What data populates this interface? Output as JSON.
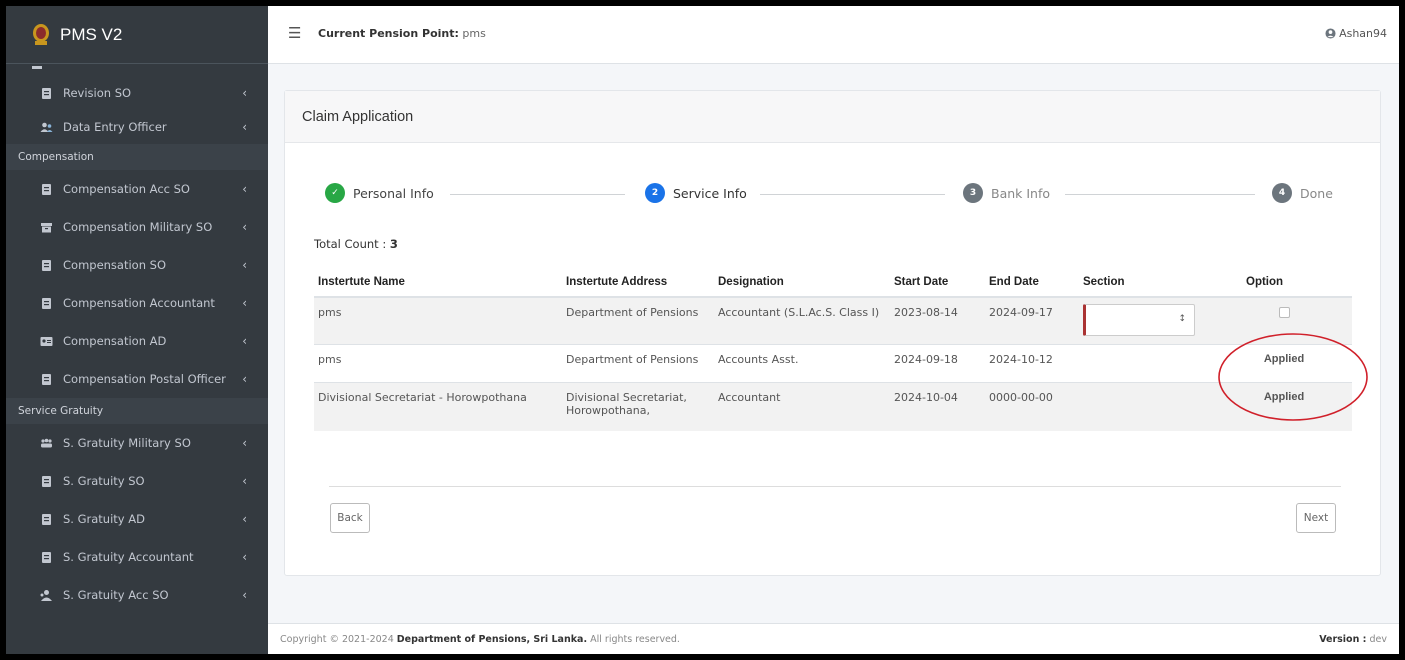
{
  "app": {
    "brand": "PMS V2"
  },
  "sidebar": {
    "items_top": [
      {
        "label": "Revision SO",
        "icon": "file-icon"
      },
      {
        "label": "Data Entry Officer",
        "icon": "users-icon"
      }
    ],
    "compensation_header": "Compensation",
    "compensation_items": [
      {
        "label": "Compensation Acc SO",
        "icon": "file-icon"
      },
      {
        "label": "Compensation Military SO",
        "icon": "archive-icon"
      },
      {
        "label": "Compensation SO",
        "icon": "file-icon"
      },
      {
        "label": "Compensation Accountant",
        "icon": "file-icon"
      },
      {
        "label": "Compensation AD",
        "icon": "id-card-icon"
      },
      {
        "label": "Compensation Postal Officer",
        "icon": "file-icon"
      }
    ],
    "gratuity_header": "Service Gratuity",
    "gratuity_items": [
      {
        "label": "S. Gratuity Military SO",
        "icon": "people-icon"
      },
      {
        "label": "S. Gratuity SO",
        "icon": "file-icon"
      },
      {
        "label": "S. Gratuity AD",
        "icon": "file-icon"
      },
      {
        "label": "S. Gratuity Accountant",
        "icon": "file-icon"
      },
      {
        "label": "S. Gratuity Acc SO",
        "icon": "user-tie-icon"
      }
    ]
  },
  "header": {
    "pension_point_label": "Current Pension Point:",
    "pension_point_value": "pms",
    "username": "Ashan94"
  },
  "card": {
    "title": "Claim Application"
  },
  "stepper": [
    {
      "number": "✓",
      "label": "Personal Info",
      "state": "completed",
      "color": "#28a745"
    },
    {
      "number": "2",
      "label": "Service Info",
      "state": "active",
      "color": "#1a73e8"
    },
    {
      "number": "3",
      "label": "Bank Info",
      "state": "pending",
      "color": "#6c757d"
    },
    {
      "number": "4",
      "label": "Done",
      "state": "pending",
      "color": "#6c757d"
    }
  ],
  "total_count": {
    "label": "Total Count :",
    "value": "3"
  },
  "table": {
    "headers": [
      "Instertute Name",
      "Instertute Address",
      "Designation",
      "Start Date",
      "End Date",
      "Section",
      "Option"
    ],
    "rows": [
      {
        "name": "pms",
        "address": "Department of Pensions",
        "designation": "Accountant (S.L.Ac.S. Class I)",
        "start": "2023-08-14",
        "end": "2024-09-17",
        "section": "",
        "option": ""
      },
      {
        "name": "pms",
        "address": "Department of Pensions",
        "designation": "Accounts Asst.",
        "start": "2024-09-18",
        "end": "2024-10-12",
        "section": "",
        "option": "Applied"
      },
      {
        "name": "Divisional Secretariat - Horowpothana",
        "address": "Divisional Secretariat, Horowpothana,",
        "designation": "Accountant",
        "start": "2024-10-04",
        "end": "0000-00-00",
        "section": "",
        "option": "Applied"
      }
    ]
  },
  "buttons": {
    "back": "Back",
    "next": "Next"
  },
  "footer": {
    "copyright_prefix": "Copyright © 2021-2024",
    "org": "Department of Pensions, Sri Lanka.",
    "rights": "All rights reserved.",
    "version_label": "Version :",
    "version_value": "dev"
  },
  "colors": {
    "sidebar_bg": "#343a40",
    "applied": "#a32020",
    "annotation": "#d0202a"
  }
}
